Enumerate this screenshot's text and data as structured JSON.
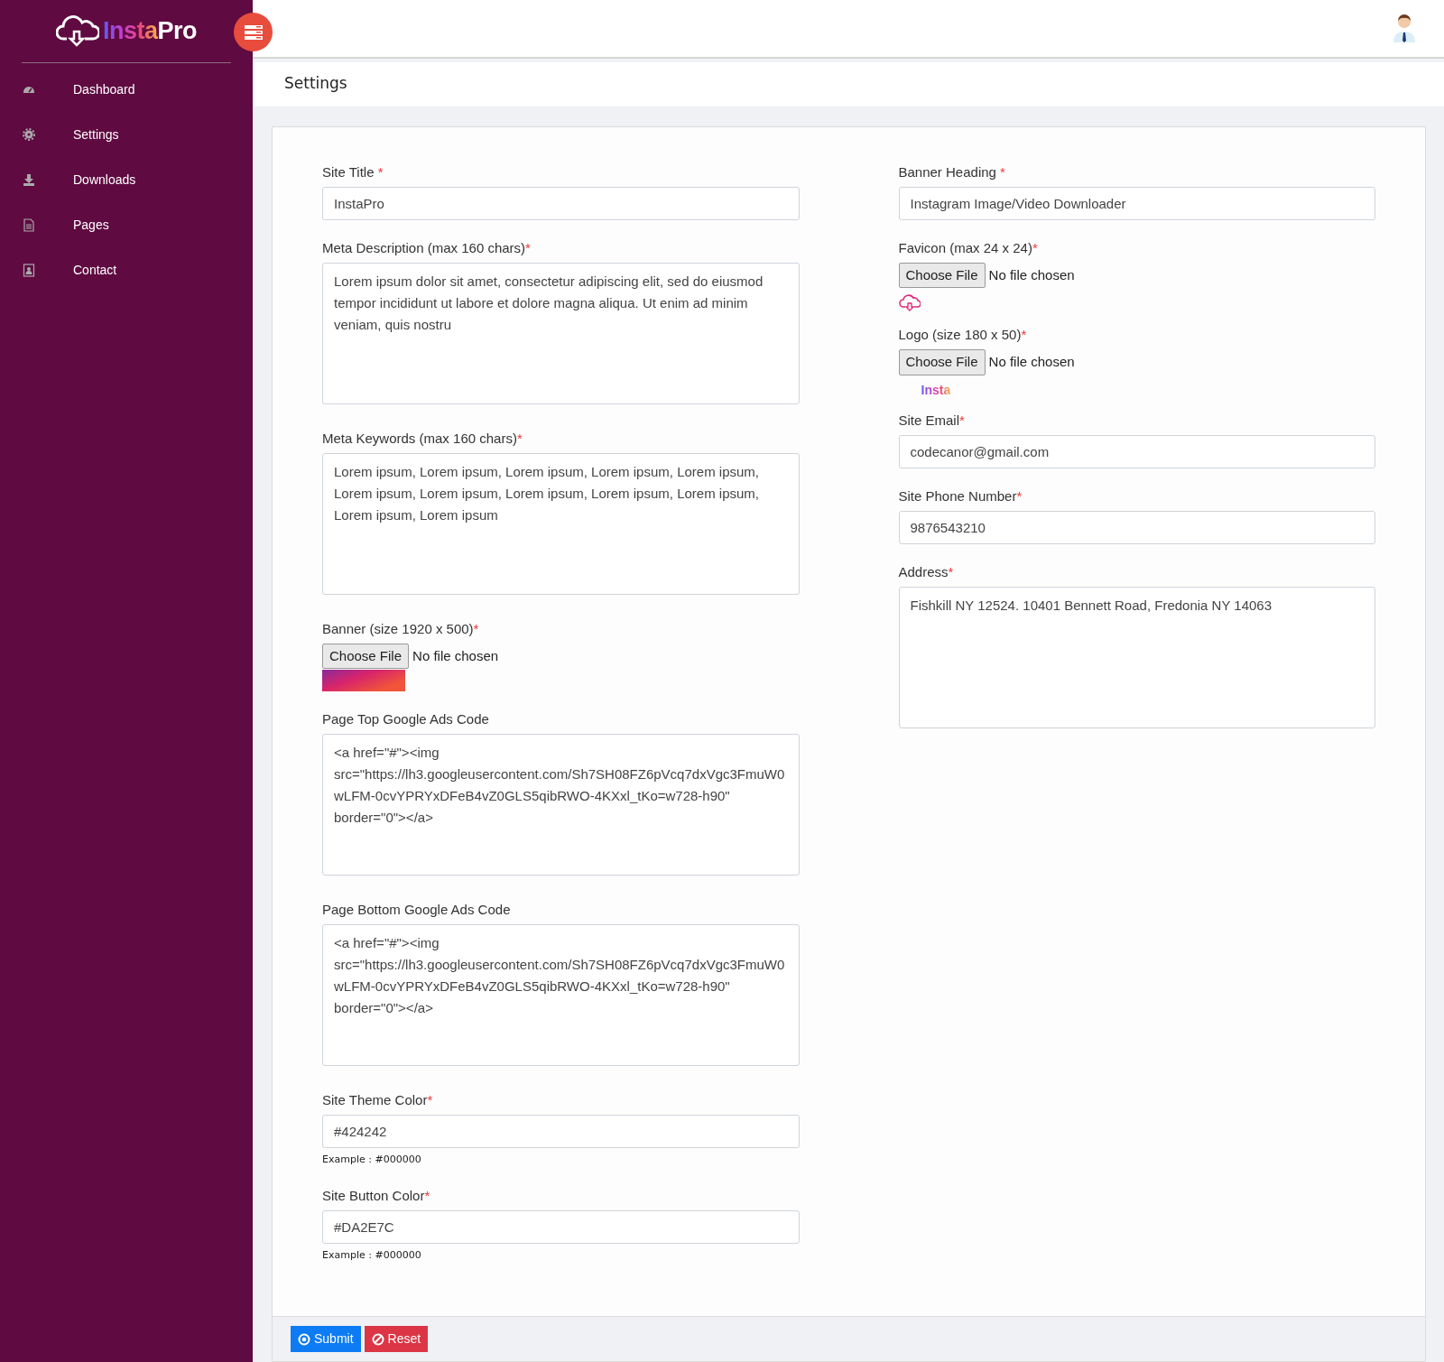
{
  "logo": {
    "accent": "Insta",
    "rest": "Pro"
  },
  "sidebar": {
    "items": [
      {
        "label": "Dashboard"
      },
      {
        "label": "Settings"
      },
      {
        "label": "Downloads"
      },
      {
        "label": "Pages"
      },
      {
        "label": "Contact"
      }
    ]
  },
  "page_title": "Settings",
  "form": {
    "left": [
      {
        "kind": "input",
        "label": "Site Title ",
        "marker": "*",
        "value": "InstaPro"
      },
      {
        "kind": "textarea",
        "label": "Meta Description (max 160 chars)",
        "marker": "*",
        "value": "Lorem ipsum dolor sit amet, consectetur adipiscing elit, sed do eiusmod tempor incididunt ut labore et dolore magna aliqua. Ut enim ad minim veniam, quis nostru"
      },
      {
        "kind": "textarea",
        "label": "Meta Keywords (max 160 chars)",
        "marker": "*",
        "value": "Lorem ipsum, Lorem ipsum, Lorem ipsum, Lorem ipsum, Lorem ipsum, Lorem ipsum, Lorem ipsum, Lorem ipsum, Lorem ipsum, Lorem ipsum, Lorem ipsum, Lorem ipsum"
      },
      {
        "kind": "banner",
        "label": "Banner (size 1920 x 500)",
        "marker": "*",
        "button": "Choose File",
        "status": "No file chosen"
      },
      {
        "kind": "textarea",
        "label": "Page Top Google Ads Code",
        "value": "<a href=\"#\"><img src=\"https://lh3.googleusercontent.com/Sh7SH08FZ6pVcq7dxVgc3FmuW0wLFM-0cvYPRYxDFeB4vZ0GLS5qibRWO-4KXxl_tKo=w728-h90\" border=\"0\"></a>"
      },
      {
        "kind": "textarea",
        "label": "Page Bottom Google Ads Code",
        "value": "<a href=\"#\"><img src=\"https://lh3.googleusercontent.com/Sh7SH08FZ6pVcq7dxVgc3FmuW0wLFM-0cvYPRYxDFeB4vZ0GLS5qibRWO-4KXxl_tKo=w728-h90\" border=\"0\"></a>"
      },
      {
        "kind": "input",
        "label": "Site Theme Color",
        "marker": "*",
        "value": "#424242",
        "hint": "Example : #000000"
      },
      {
        "kind": "input",
        "label": "Site Button Color",
        "marker": "*",
        "value": "#DA2E7C",
        "hint": "Example : #000000"
      }
    ],
    "right": [
      {
        "kind": "input",
        "label": "Banner Heading ",
        "marker": "*",
        "value": "Instagram Image/Video Downloader"
      },
      {
        "kind": "favicon",
        "label": "Favicon (max 24 x 24)",
        "marker": "*",
        "button": "Choose File",
        "status": "No file chosen"
      },
      {
        "kind": "logo",
        "label": "Logo (size 180 x 50)",
        "marker": "*",
        "button": "Choose File",
        "status": "No file chosen",
        "preview_text": "Insta"
      },
      {
        "kind": "input",
        "label": "Site Email",
        "marker": "*",
        "value": "codecanor@gmail.com"
      },
      {
        "kind": "input",
        "label": "Site Phone Number",
        "marker": "*",
        "value": "9876543210"
      },
      {
        "kind": "textarea",
        "label": "Address",
        "marker": "*",
        "value": "Fishkill NY 12524. 10401 Bennett Road, Fredonia NY 14063"
      }
    ]
  },
  "buttons": [
    {
      "label": "Submit",
      "kind": "primary"
    },
    {
      "label": "Reset",
      "kind": "danger"
    }
  ]
}
